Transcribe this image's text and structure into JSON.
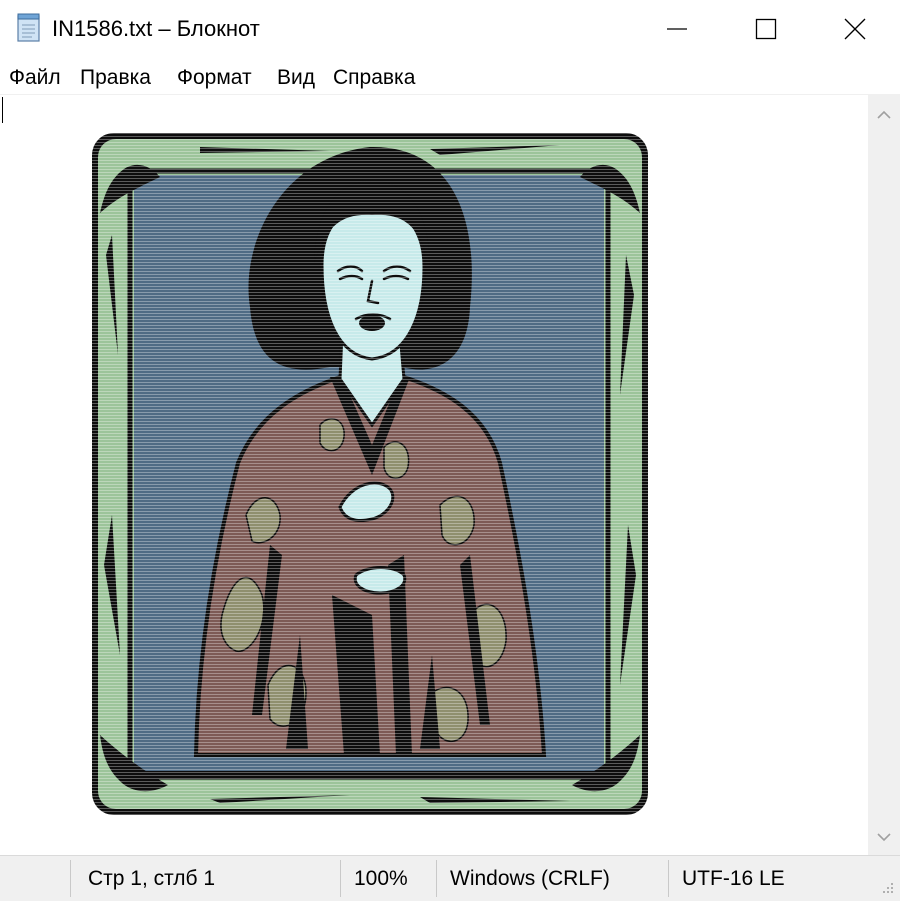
{
  "window": {
    "title": "IN1586.txt – Блокнот",
    "icon": "notepad-icon",
    "controls": [
      "minimize-icon",
      "maximize-icon",
      "close-icon"
    ]
  },
  "menu": {
    "file": "Файл",
    "edit": "Правка",
    "format": "Формат",
    "view": "Вид",
    "help": "Справка"
  },
  "document": {
    "content_kind": "ascii-art-image",
    "subject": "framed portrait of a woman with black bob hair in a brown patterned kimono",
    "colors": {
      "frame": "#9cc49a",
      "background": "#4f6b84",
      "skin": "#c7eaea",
      "hair": "#0d0d0d",
      "kimono": "#7d5a55",
      "kimono_pattern": "#8f8f6e"
    }
  },
  "status": {
    "position": "Стр 1, стлб 1",
    "zoom": "100%",
    "line_endings": "Windows (CRLF)",
    "encoding": "UTF-16 LE"
  }
}
